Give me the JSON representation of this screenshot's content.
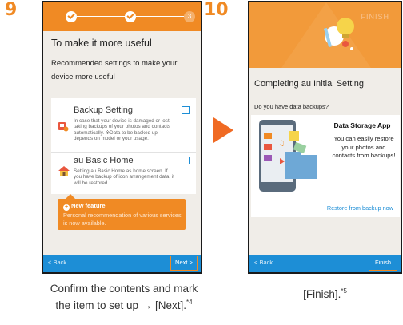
{
  "step1": {
    "number": "9",
    "title": "To make it more useful",
    "subtitle": "Recommended settings to make your device more useful",
    "stepper_current": "3",
    "options": [
      {
        "title": "Backup Setting",
        "desc": "In case that your device is damaged or lost, taking backups of your photos and contacts automatically. ※Data to be backed up depends on model or your usage.",
        "icon": "backup-icon"
      },
      {
        "title": "au Basic Home",
        "desc": "Setting au Basic Home as home screen. If you have backup of icon arrangement data, it will be restored.",
        "icon": "home-icon"
      }
    ],
    "balloon": {
      "title": "New feature",
      "text": "Personal recommendation of various services is now available."
    },
    "back_label": "< Back",
    "next_label": "Next >",
    "caption_line1": "Confirm the contents and mark",
    "caption_line2": "the item to set up → [Next].",
    "caption_note": "*4"
  },
  "step2": {
    "number": "10",
    "banner_word": "FINISH",
    "title": "Completing au Initial Setting",
    "question": "Do you have data backups?",
    "card_title": "Data Storage App",
    "card_desc": "You can easily restore your photos and contacts from backups!",
    "restore_link": "Restore from backup now",
    "back_label": "< Back",
    "finish_label": "Finish",
    "caption": "[Finish].",
    "caption_note": "*5"
  },
  "colors": {
    "accent": "#f08a24",
    "blue": "#1d8ed6",
    "arrow": "#f06a23"
  }
}
